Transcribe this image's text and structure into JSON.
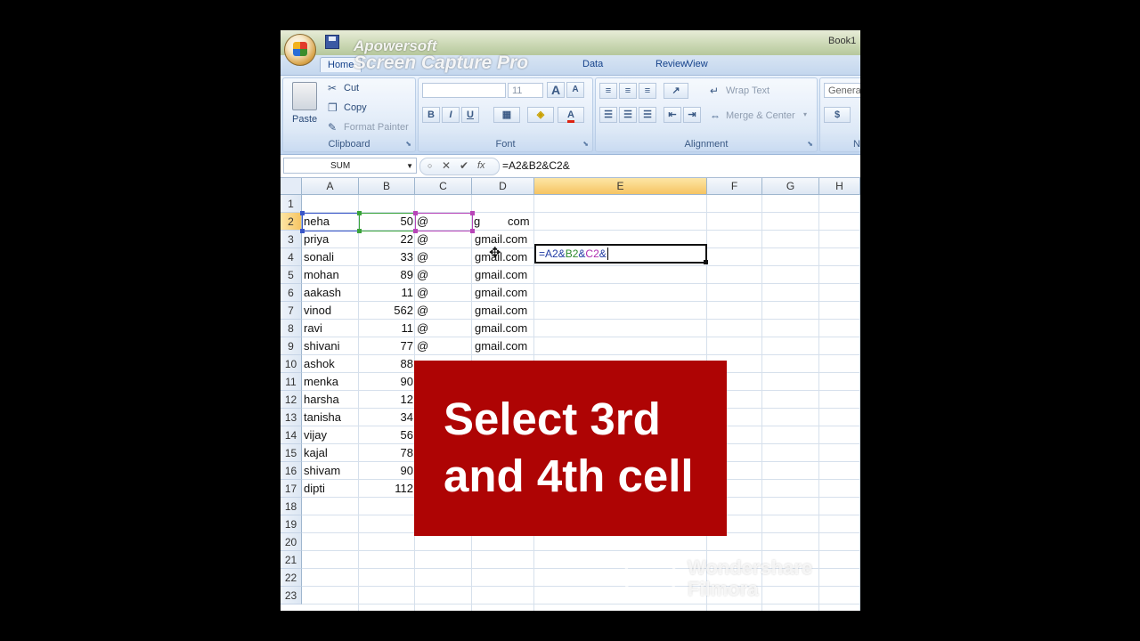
{
  "window": {
    "title": "Book1",
    "watermark_line1": "Apowersoft",
    "watermark_line2": "Screen Capture Pro"
  },
  "tabs": [
    {
      "label": "Home",
      "active": true
    },
    {
      "label": "Data",
      "active": false
    },
    {
      "label": "Review",
      "active": false
    },
    {
      "label": "View",
      "active": false
    }
  ],
  "ribbon": {
    "clipboard": {
      "paste": "Paste",
      "cut": "Cut",
      "copy": "Copy",
      "format_painter": "Format Painter",
      "label": "Clipboard"
    },
    "font": {
      "font_size": "11",
      "bold": "B",
      "italic": "I",
      "underline": "U",
      "grow": "A",
      "shrink": "A",
      "font_color": "A",
      "label": "Font"
    },
    "alignment": {
      "wrap_text": "Wrap Text",
      "merge_center": "Merge & Center",
      "label": "Alignment"
    },
    "number": {
      "format": "Genera",
      "currency": "$",
      "label": "N"
    }
  },
  "formula_bar": {
    "name_box": "SUM",
    "fx": "fx",
    "formula": "=A2&B2&C2&"
  },
  "sheet": {
    "columns": [
      "A",
      "B",
      "C",
      "D",
      "E",
      "F",
      "G",
      "H"
    ],
    "selected_column": "E",
    "rows": [
      "1",
      "2",
      "3",
      "4",
      "5",
      "6",
      "7",
      "8",
      "9",
      "10",
      "11",
      "12",
      "13",
      "14",
      "15",
      "16",
      "17",
      "18",
      "19",
      "20",
      "21",
      "22",
      "23"
    ],
    "selected_row": "2",
    "names": [
      "neha",
      "priya",
      "sonali",
      "mohan",
      "aakash",
      "vinod",
      "ravi",
      "shivani",
      "ashok",
      "menka",
      "harsha",
      "tanisha",
      "vijay",
      "kajal",
      "shivam",
      "dipti"
    ],
    "numbers": [
      "50",
      "22",
      "33",
      "89",
      "11",
      "562",
      "11",
      "77",
      "88",
      "90",
      "12",
      "34",
      "56",
      "78",
      "90",
      "112"
    ],
    "at_values": [
      "@",
      "@",
      "@",
      "@",
      "@",
      "@",
      "@",
      "@"
    ],
    "domain_values": [
      "gmail.com",
      "gmail.com",
      "gmail.com",
      "gmail.com",
      "gmail.com",
      "gmail.com",
      "gmail.com"
    ],
    "d2_left": "g",
    "d2_right": "com",
    "active_cell": {
      "parts": [
        "=A2&",
        "B2",
        "&",
        "C2",
        "&"
      ],
      "part_colors": [
        "#1f3aa3",
        "#2e8b2e",
        "#1f3aa3",
        "#b02fb0",
        "#1f3aa3"
      ]
    },
    "ref_colors": {
      "A2": "#3a56c8",
      "B2": "#3aa33a",
      "C2": "#b845b8"
    }
  },
  "overlay": {
    "line1": "Select 3rd",
    "line2": "and 4th cell",
    "color": "#ae0404"
  },
  "watermark": {
    "line1": "Wondershare",
    "line2": "Filmora"
  }
}
